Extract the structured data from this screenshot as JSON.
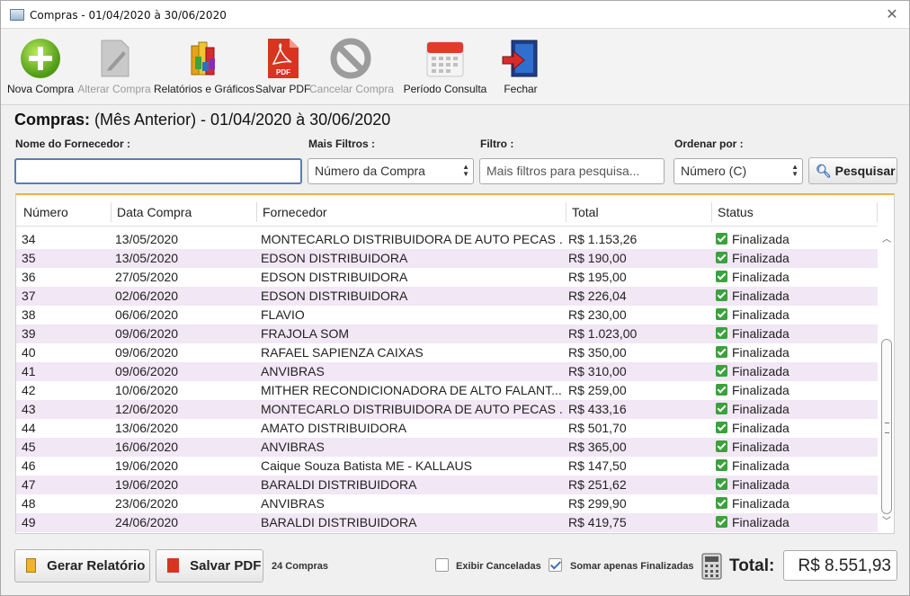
{
  "window": {
    "title": "Compras - 01/04/2020 à 30/06/2020",
    "close_icon": "close-icon"
  },
  "toolbar": {
    "nova": "Nova Compra",
    "alterar": "Alterar Compra",
    "relatorios": "Relatórios e Gráficos",
    "salvar_pdf": "Salvar PDF",
    "cancelar": "Cancelar Compra",
    "periodo": "Período Consulta",
    "fechar": "Fechar"
  },
  "heading": {
    "bold": "Compras:",
    "rest": "(Mês Anterior) - 01/04/2020 à 30/06/2020"
  },
  "filters": {
    "fornecedor_label": "Nome do Fornecedor :",
    "fornecedor_value": "",
    "mais_filtros_label": "Mais Filtros :",
    "mais_filtros_value": "Número da Compra",
    "filtro_label": "Filtro :",
    "filtro_placeholder": "Mais filtros para pesquisa...",
    "ordenar_label": "Ordenar por :",
    "ordenar_value": "Número (C)",
    "pesquisar": "Pesquisar"
  },
  "table": {
    "headers": [
      "Número",
      "Data Compra",
      "Fornecedor",
      "Total",
      "Status"
    ],
    "rows": [
      [
        "34",
        "13/05/2020",
        "MONTECARLO DISTRIBUIDORA DE AUTO PECAS ...",
        "R$ 1.153,26",
        "Finalizada"
      ],
      [
        "35",
        "13/05/2020",
        "EDSON DISTRIBUIDORA",
        "R$ 190,00",
        "Finalizada"
      ],
      [
        "36",
        "27/05/2020",
        "EDSON DISTRIBUIDORA",
        "R$ 195,00",
        "Finalizada"
      ],
      [
        "37",
        "02/06/2020",
        "EDSON DISTRIBUIDORA",
        "R$ 226,04",
        "Finalizada"
      ],
      [
        "38",
        "06/06/2020",
        "FLAVIO",
        "R$ 230,00",
        "Finalizada"
      ],
      [
        "39",
        "09/06/2020",
        "FRAJOLA SOM",
        "R$ 1.023,00",
        "Finalizada"
      ],
      [
        "40",
        "09/06/2020",
        "RAFAEL SAPIENZA CAIXAS",
        "R$ 350,00",
        "Finalizada"
      ],
      [
        "41",
        "09/06/2020",
        "ANVIBRAS",
        "R$ 310,00",
        "Finalizada"
      ],
      [
        "42",
        "10/06/2020",
        "MITHER RECONDICIONADORA DE ALTO FALANT...",
        "R$ 259,00",
        "Finalizada"
      ],
      [
        "43",
        "12/06/2020",
        "MONTECARLO DISTRIBUIDORA DE AUTO PECAS ...",
        "R$ 433,16",
        "Finalizada"
      ],
      [
        "44",
        "13/06/2020",
        "AMATO DISTRIBUIDORA",
        "R$ 501,70",
        "Finalizada"
      ],
      [
        "45",
        "16/06/2020",
        "ANVIBRAS",
        "R$ 365,00",
        "Finalizada"
      ],
      [
        "46",
        "19/06/2020",
        "Caique Souza Batista ME - KALLAUS",
        "R$ 147,50",
        "Finalizada"
      ],
      [
        "47",
        "19/06/2020",
        "BARALDI DISTRIBUIDORA",
        "R$ 251,62",
        "Finalizada"
      ],
      [
        "48",
        "23/06/2020",
        "ANVIBRAS",
        "R$ 299,90",
        "Finalizada"
      ],
      [
        "49",
        "24/06/2020",
        "BARALDI DISTRIBUIDORA",
        "R$ 419,75",
        "Finalizada"
      ]
    ]
  },
  "footer": {
    "gerar_relatorio": "Gerar Relatório",
    "salvar_pdf": "Salvar PDF",
    "count": "24 Compras",
    "exibir_canceladas": "Exibir Canceladas",
    "exibir_canceladas_checked": false,
    "somar_finalizadas": "Somar apenas Finalizadas",
    "somar_finalizadas_checked": true,
    "total_label": "Total:",
    "total_value": "R$ 8.551,93"
  },
  "colors": {
    "accent_orange": "#f0b04a",
    "row_alt": "#f1e7f5",
    "status_green": "#3aa23a"
  }
}
